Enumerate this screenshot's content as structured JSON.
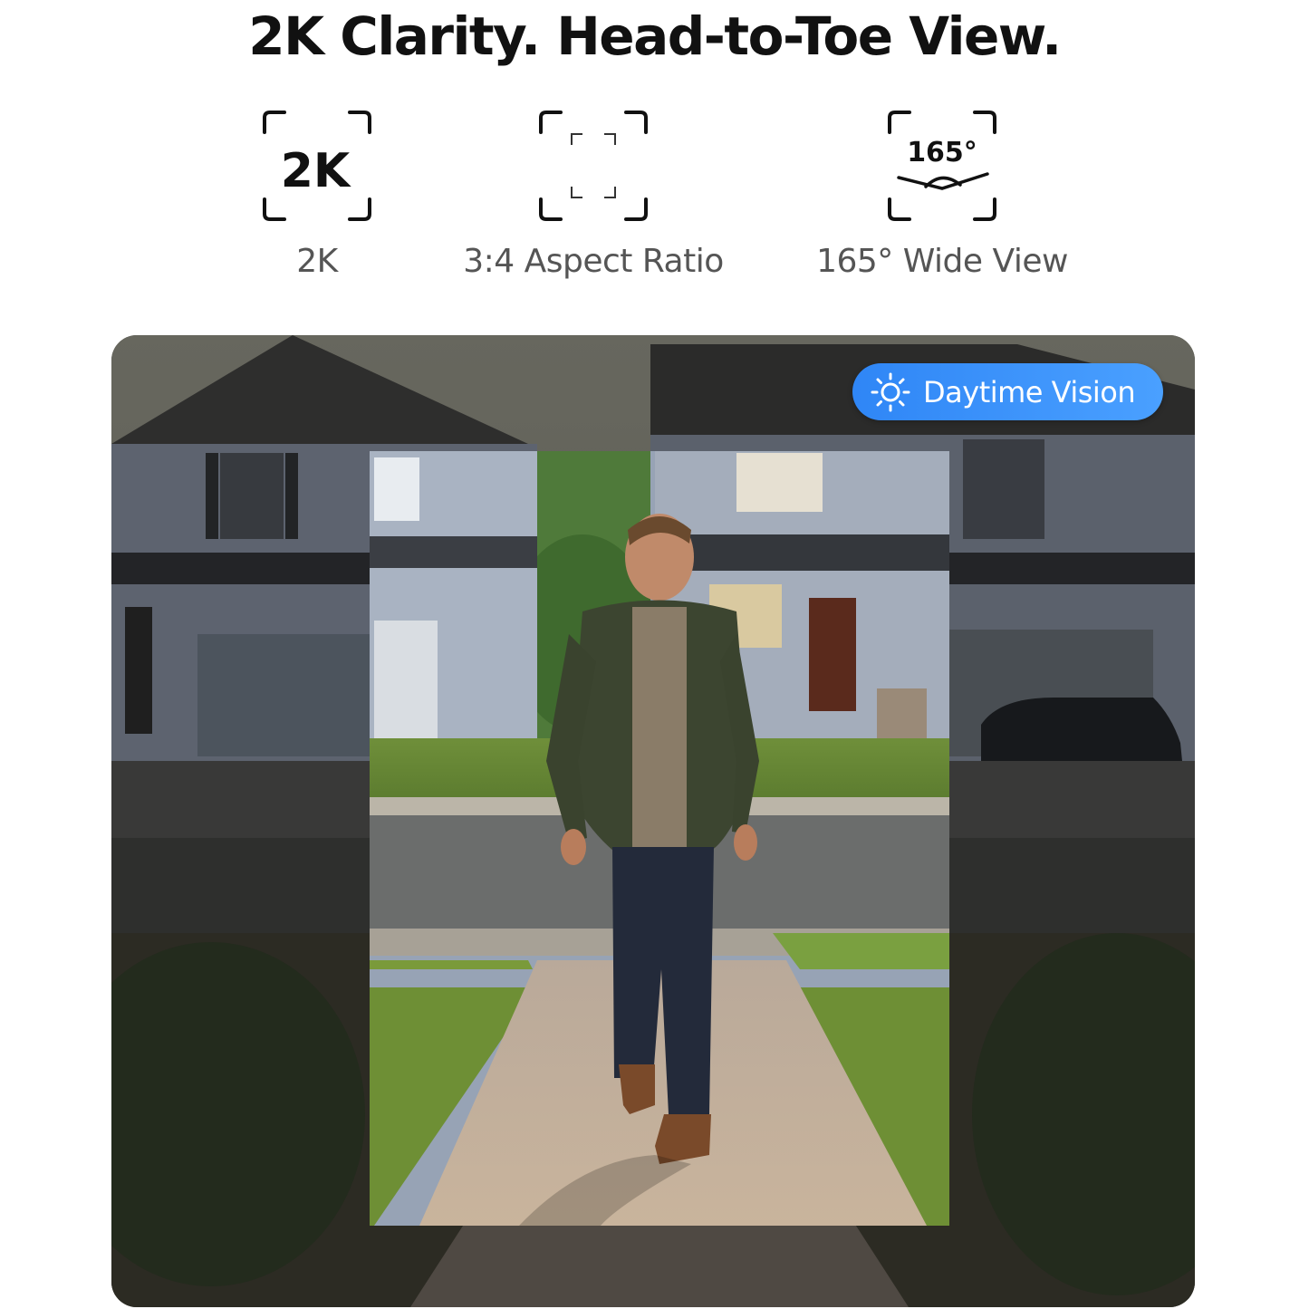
{
  "headline": "2K Clarity. Head-to-Toe View.",
  "features": [
    {
      "icon": "2k-resolution-icon",
      "icon_text": "2K",
      "label": "2K"
    },
    {
      "icon": "aspect-ratio-icon",
      "label": "3:4 Aspect Ratio"
    },
    {
      "icon": "wide-angle-icon",
      "icon_text": "165°",
      "label": "165° Wide View"
    }
  ],
  "badge": {
    "icon": "sun-icon",
    "label": "Daytime Vision"
  },
  "colors": {
    "badge": "#3a93fa",
    "headline": "#111111",
    "label": "#555555"
  }
}
